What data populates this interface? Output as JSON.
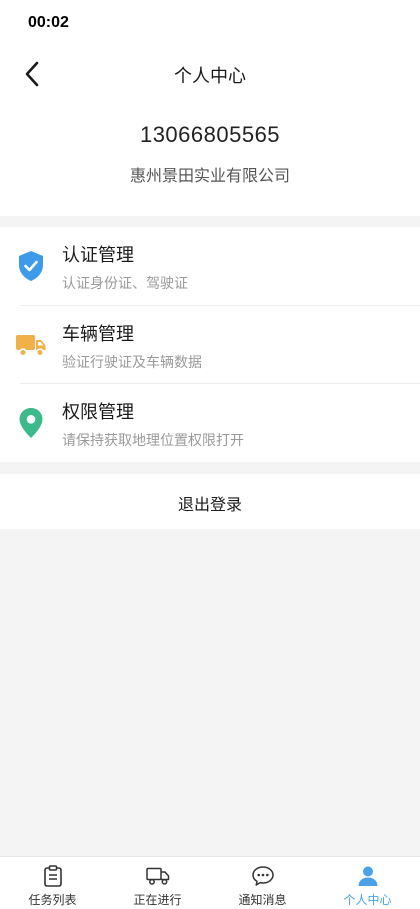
{
  "status_bar": {
    "time": "00:02"
  },
  "nav": {
    "title": "个人中心"
  },
  "profile": {
    "phone": "13066805565",
    "company": "惠州景田实业有限公司"
  },
  "menu": {
    "items": [
      {
        "title": "认证管理",
        "subtitle": "认证身份证、驾驶证",
        "icon": "shield-check-icon",
        "color": "#3d9be9"
      },
      {
        "title": "车辆管理",
        "subtitle": "验证行驶证及车辆数据",
        "icon": "truck-icon",
        "color": "#f0b04a"
      },
      {
        "title": "权限管理",
        "subtitle": "请保持获取地理位置权限打开",
        "icon": "location-pin-icon",
        "color": "#3cba8c"
      }
    ]
  },
  "logout": {
    "label": "退出登录"
  },
  "tab_bar": {
    "active": "个人中心",
    "active_color": "#4aa3e8",
    "tabs": [
      {
        "label": "任务列表",
        "icon": "clipboard-icon"
      },
      {
        "label": "正在进行",
        "icon": "truck-outline-icon"
      },
      {
        "label": "通知消息",
        "icon": "chat-bubble-icon"
      },
      {
        "label": "个人中心",
        "icon": "user-icon"
      }
    ]
  }
}
